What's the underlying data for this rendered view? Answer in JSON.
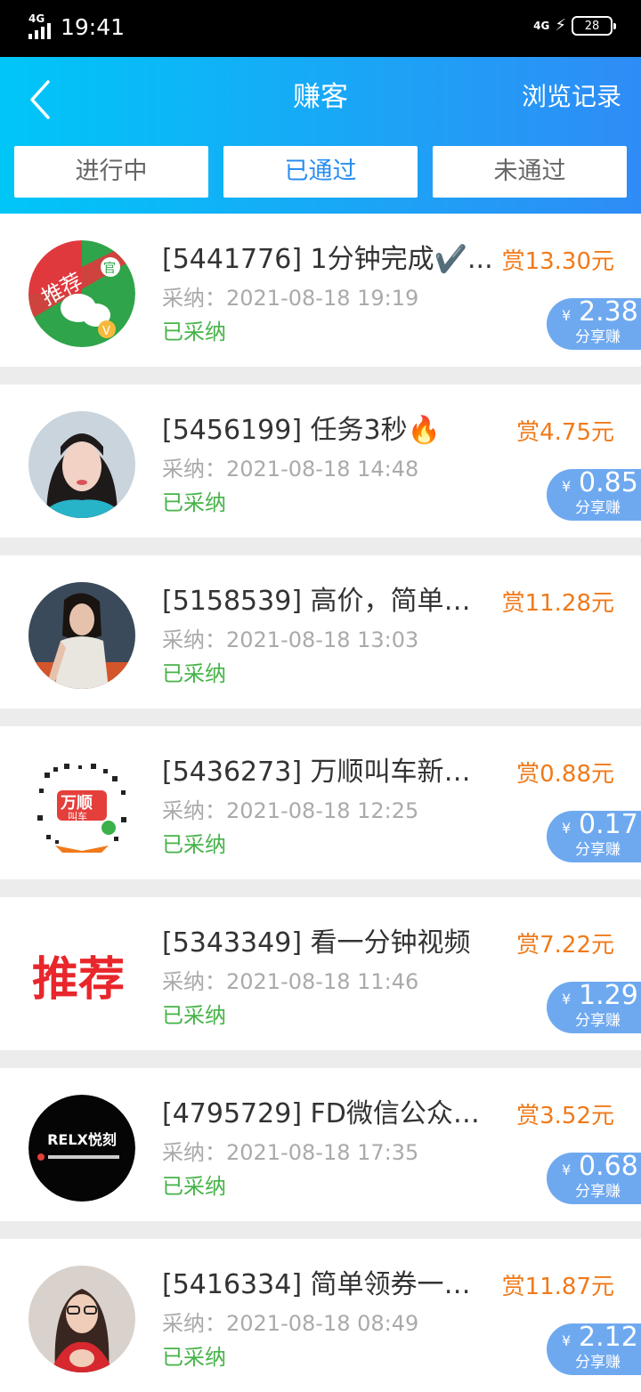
{
  "status_bar": {
    "time": "19:41",
    "network_left": "4G",
    "network_right": "4G",
    "battery": "28"
  },
  "header": {
    "title": "赚客",
    "history_link": "浏览记录",
    "back_icon": "chevron-left-icon",
    "gradient_start": "#00c6f7",
    "gradient_end": "#2f8cf6"
  },
  "tabs": [
    {
      "label": "进行中",
      "active": false
    },
    {
      "label": "已通过",
      "active": true
    },
    {
      "label": "未通过",
      "active": false
    }
  ],
  "colors": {
    "reward": "#f07a1a",
    "status_green": "#47b349",
    "share_badge": "#6ea9f0",
    "active_tab": "#2a8ef0"
  },
  "items": [
    {
      "title": "[5441776] 1分钟完成✔️...",
      "reward": "赏13.30元",
      "date_label": "采纳：",
      "date": "2021-08-18 19:19",
      "status": "已采纳",
      "yen": "¥",
      "share_amount": "2.38",
      "share_label": "分享赚",
      "avatar": "wechat-recommend-logo"
    },
    {
      "title": "[5456199] 任务3秒🔥",
      "reward": "赏4.75元",
      "date_label": "采纳：",
      "date": "2021-08-18 14:48",
      "status": "已采纳",
      "yen": "¥",
      "share_amount": "0.85",
      "share_label": "分享赚",
      "avatar": "user-photo-woman"
    },
    {
      "title": "[5158539] 高价，简单，...",
      "reward": "赏11.28元",
      "date_label": "采纳：",
      "date": "2021-08-18 13:03",
      "status": "已采纳",
      "yen": "¥",
      "share_amount": "",
      "share_label": "",
      "avatar": "user-photo-woman-dark"
    },
    {
      "title": "[5436273] 万顺叫车新人...",
      "reward": "赏0.88元",
      "date_label": "采纳：",
      "date": "2021-08-18 12:25",
      "status": "已采纳",
      "yen": "¥",
      "share_amount": "0.17",
      "share_label": "分享赚",
      "avatar": "wanshun-miniprogram-code"
    },
    {
      "title": "[5343349] 看一分钟视频",
      "reward": "赏7.22元",
      "date_label": "采纳：",
      "date": "2021-08-18 11:46",
      "status": "已采纳",
      "yen": "¥",
      "share_amount": "1.29",
      "share_label": "分享赚",
      "avatar": "recommend-text-logo",
      "avatar_text": "推荐"
    },
    {
      "title": "[4795729] FD微信公众号...",
      "reward": "赏3.52元",
      "date_label": "采纳：",
      "date": "2021-08-18 17:35",
      "status": "已采纳",
      "yen": "¥",
      "share_amount": "0.68",
      "share_label": "分享赚",
      "avatar": "relx-logo",
      "avatar_text": "RELX悦刻"
    },
    {
      "title": "[5416334] 简单领券一张...",
      "reward": "赏11.87元",
      "date_label": "采纳：",
      "date": "2021-08-18 08:49",
      "status": "已采纳",
      "yen": "¥",
      "share_amount": "2.12",
      "share_label": "分享赚",
      "avatar": "user-photo-woman-red"
    }
  ]
}
